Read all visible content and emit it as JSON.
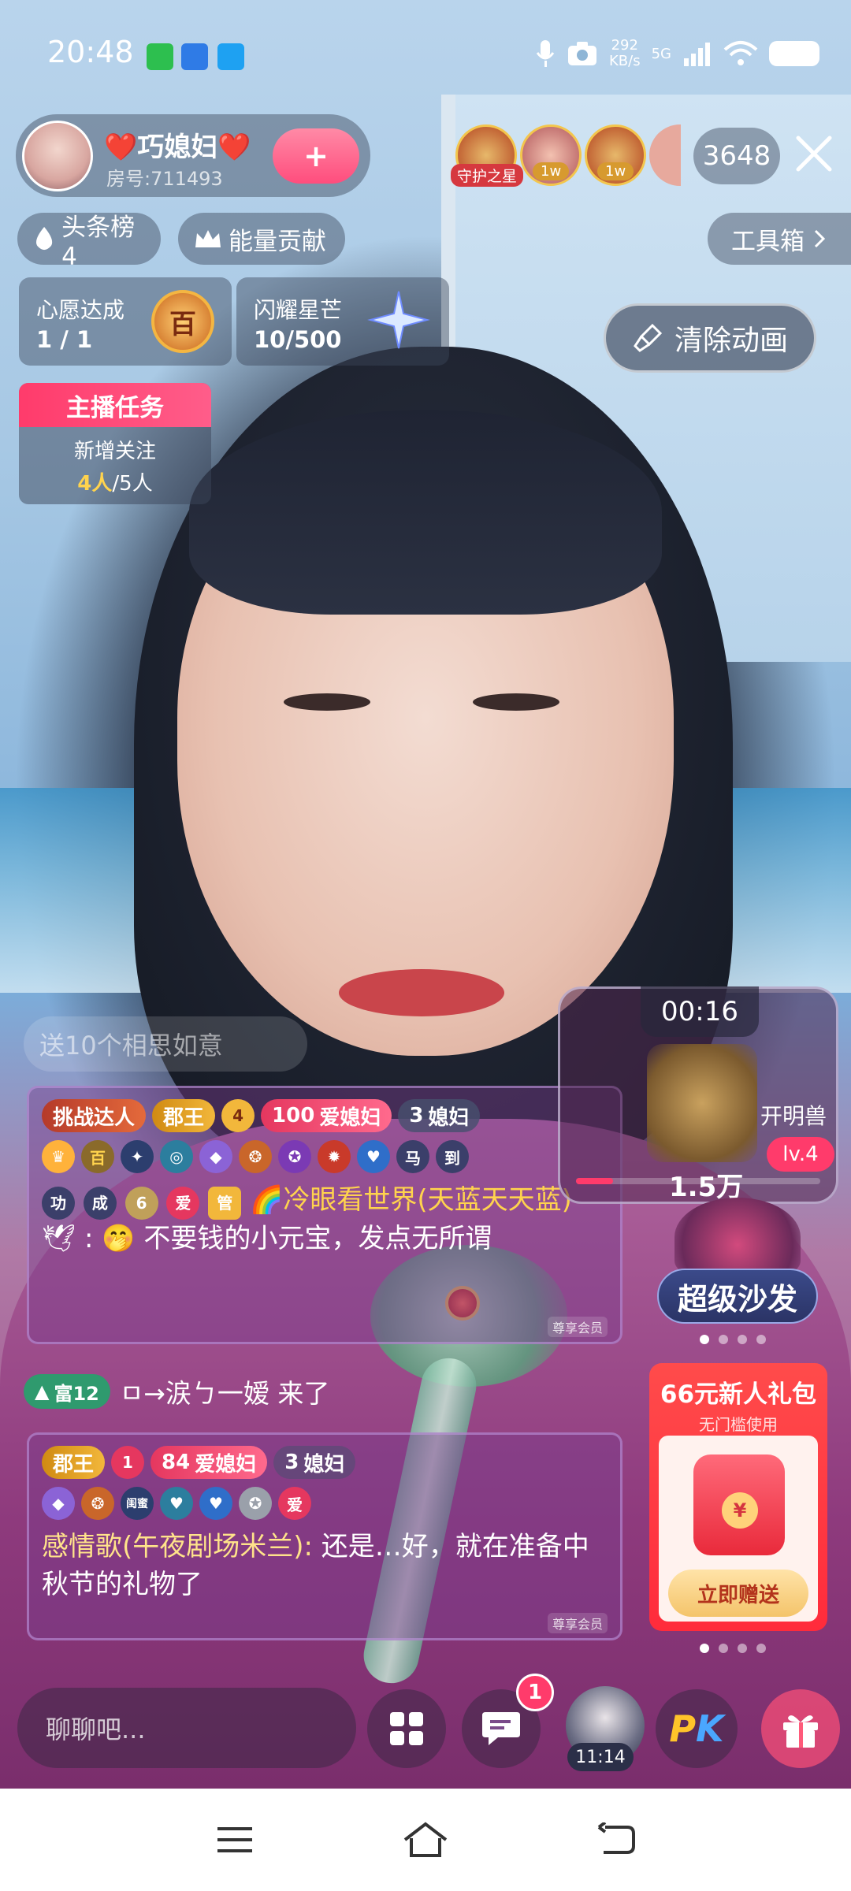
{
  "status_bar": {
    "time": "20:48",
    "net_speed": "292",
    "net_unit": "KB/s",
    "network": "5G"
  },
  "host": {
    "name": "❤️巧媳妇❤️",
    "room": "房号:711493",
    "follow_symbol": "+"
  },
  "viewers": {
    "guard_label": "守护之星",
    "tags": [
      "1w",
      "1w"
    ],
    "count": "3648"
  },
  "pills": {
    "headline": "头条榜4",
    "energy": "能量贡献",
    "toolbox": "工具箱"
  },
  "cards": {
    "wish_title": "心愿达成",
    "wish_value": "1 / 1",
    "wish_badge": "百",
    "star_title": "闪耀星芒",
    "star_value": "10/500"
  },
  "clear_animation": "清除动画",
  "host_task": {
    "title": "主播任务",
    "subtitle": "新增关注",
    "done": "4人",
    "total": "/5人"
  },
  "chat": {
    "faded": "送10个相思如意",
    "msg1": {
      "badges": [
        "挑战达人",
        "郡王",
        "4",
        "100",
        "爱媳妇",
        "3",
        "媳妇"
      ],
      "medals": [
        "百",
        "马",
        "到",
        "功",
        "成",
        "爱",
        "管"
      ],
      "nick": "🌈冷眼看世界(天蓝天天蓝)",
      "content": "不要钱的小元宝，发点无所谓",
      "member": "尊享会员"
    },
    "entry": {
      "badge": "富12",
      "text": "ㅁ→涙ㄅ一嫒 来了"
    },
    "msg2": {
      "badges": [
        "郡王",
        "1",
        "84",
        "爱媳妇",
        "3",
        "媳妇"
      ],
      "medals": [
        "闺蜜",
        "爱"
      ],
      "nick": "感情歌(午夜剧场米兰):",
      "content": "还是…好，就在准备中秋节的礼物了",
      "member": "尊享会员"
    }
  },
  "pk": {
    "timer": "00:16",
    "beast": "开明兽",
    "level": "lv.4",
    "score": "1.5万",
    "progress": 0.15
  },
  "super_sofa": "超级沙发",
  "gift_pack": {
    "title": "66元新人礼包",
    "subtitle": "无门槛使用",
    "coin": "¥",
    "button": "立即赠送"
  },
  "bottom": {
    "input_placeholder": "聊聊吧...",
    "notif_count": "1",
    "avatar_time": "11:14",
    "pk_p": "P",
    "pk_k": "K"
  },
  "colors": {
    "accent_pink": "#ff3b6b",
    "gold": "#ffd34d"
  }
}
